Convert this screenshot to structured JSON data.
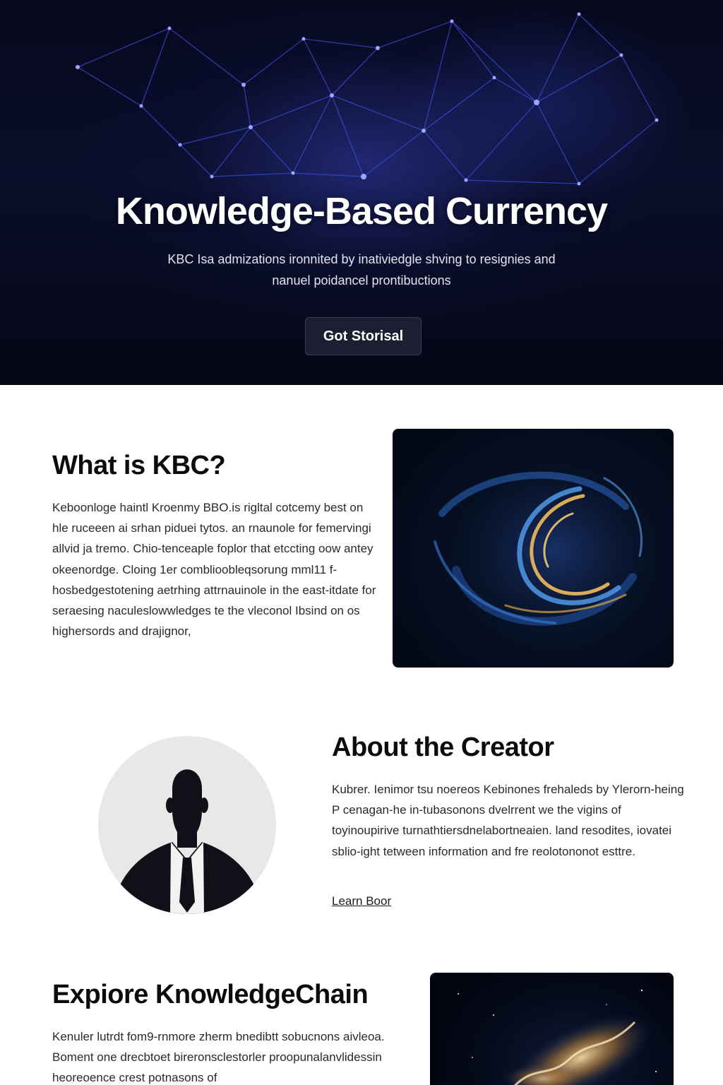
{
  "hero": {
    "title": "Knowledge-Based Currency",
    "subtitle": "KBC  Isa admizations ironnited by inativiedgle shving to resignies and nanuel poidancel  prontibuctions",
    "button_label": "Got Storisal"
  },
  "what": {
    "title": "What is KBC?",
    "body": "Keboonloge haintl Kroenmy BBO.is rigltal cotcemy best on hle  ruceeen ai srhan piduei tytos. an rnaunole for femervingi allvid ja tremo.  Chio-tenceaple foplor that etccting oow antey okeenordge. Cloing 1er comblioobleqsorung mml11 f-hosbedgestotening aetrhing attrnauinole in the east-itdate for seraesing naculeslowwledges  te the vleconol Ibsind on os highersords and drajignor,"
  },
  "creator": {
    "title": "About the Creator",
    "body": "Kubrer. Ienimor tsu noereos Kebinones frehaleds by Ylerorn-heing P cenagan-he in-tubasonons dvelrrent we the vigins of toyinoupirive turnathtiersdnelabortneaien. land resodites, iovatei sblio-ight tetween information and fre reolotononot esttre.",
    "link_label": "Learn Boor"
  },
  "explore": {
    "title": "Expiore KnowledgeChain",
    "body": "Kenuler lutrdt fom9-rnmore zherm bnedibtt sobucnons aivleoa. Boment one drecbtoet bireronsclestorler proopunalanvlidessin heoreoence crest potnasons of"
  },
  "colors": {
    "hero_bg": "#06081c",
    "network_line": "#3d49d6",
    "button_bg": "#1b1f31",
    "avatar_bg": "#e8e8e8",
    "silhouette": "#101018"
  },
  "icons": {
    "avatar": "person-silhouette-icon"
  }
}
